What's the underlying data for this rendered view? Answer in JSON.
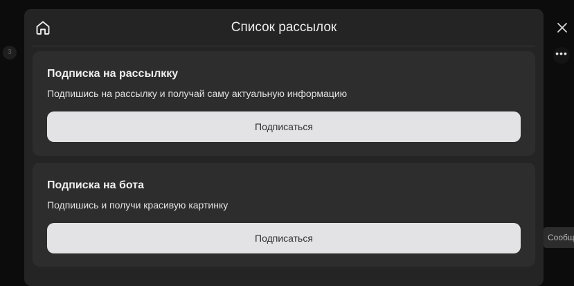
{
  "background": {
    "badge_text": "3",
    "chip_text": "Сообщени"
  },
  "modal": {
    "title": "Список рассылок",
    "home_icon": "home-icon",
    "close_icon": "close-icon"
  },
  "subscriptions": [
    {
      "title": "Подписка на рассылкку",
      "description": "Подпишись на рассылку и получай саму актуальную информацию",
      "button_label": "Подписаться"
    },
    {
      "title": "Подписка на бота",
      "description": "Подпишись и получи красивую картинку",
      "button_label": "Подписаться"
    }
  ],
  "colors": {
    "modal_bg": "#242424",
    "card_bg": "#2d2d2d",
    "button_bg": "#e3e3e6"
  }
}
